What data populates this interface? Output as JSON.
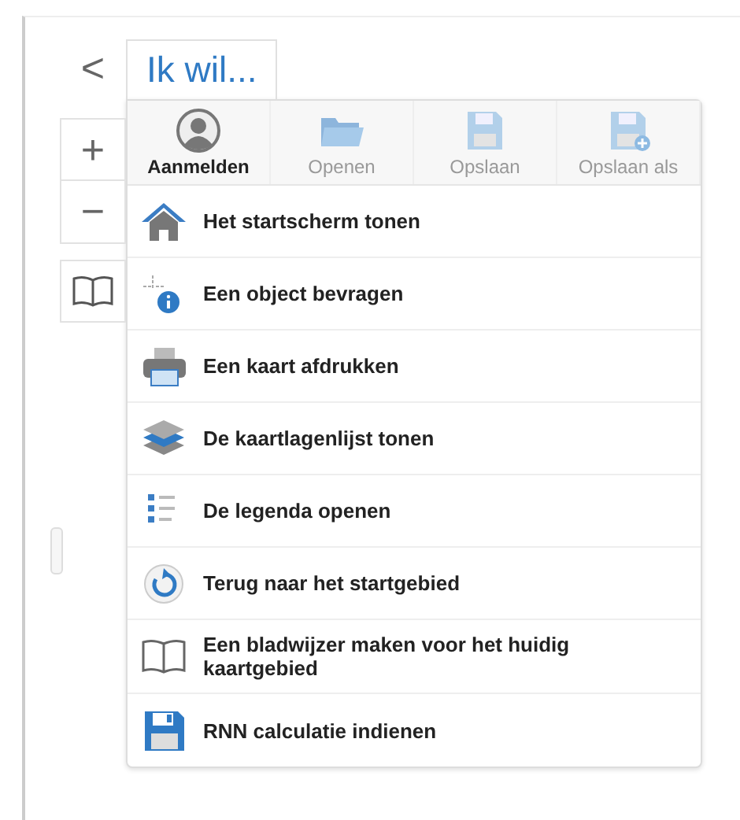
{
  "side_buttons": [
    {
      "kind": "back",
      "label": "<"
    },
    {
      "kind": "zoom-in",
      "label": "+"
    },
    {
      "kind": "zoom-out",
      "label": "−"
    },
    {
      "kind": "bookmark"
    }
  ],
  "tab": {
    "label": "Ik wil...",
    "selected": true
  },
  "toolbar": [
    {
      "label": "Aanmelden",
      "disabled": false
    },
    {
      "label": "Openen",
      "disabled": true
    },
    {
      "label": "Opslaan",
      "disabled": true
    },
    {
      "label": "Opslaan als",
      "disabled": true
    }
  ],
  "actions": [
    {
      "label": "Het startscherm tonen"
    },
    {
      "label": "Een object bevragen"
    },
    {
      "label": "Een kaart afdrukken"
    },
    {
      "label": "De kaartlagenlijst tonen"
    },
    {
      "label": "De legenda openen"
    },
    {
      "label": "Terug naar het startgebied"
    },
    {
      "label": "Een bladwijzer maken voor het huidig kaartgebied"
    },
    {
      "label": "RNN calculatie indienen"
    }
  ]
}
